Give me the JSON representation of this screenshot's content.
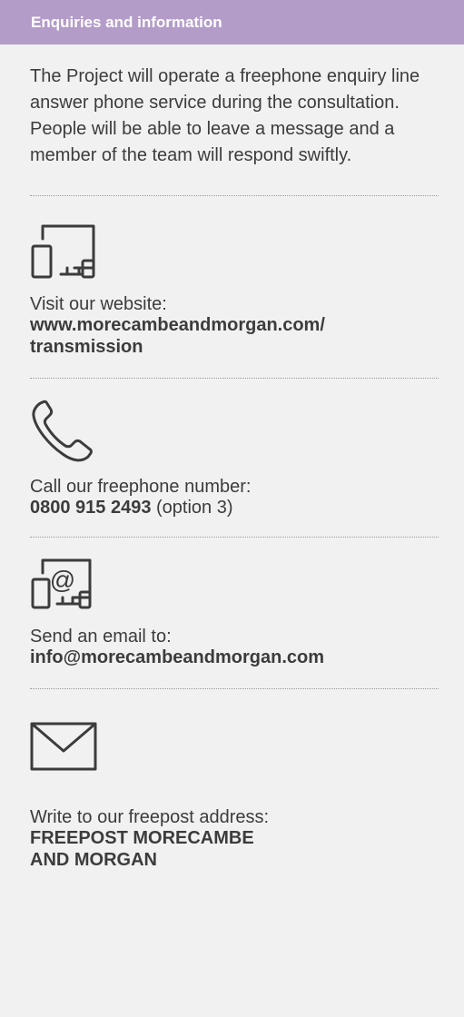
{
  "header": {
    "title": "Enquiries and information"
  },
  "intro": {
    "text": "The Project will operate a freephone enquiry line answer phone service during the consultation. People will be able to leave a message and a member of the team will respond swiftly."
  },
  "contacts": {
    "website": {
      "icon": "devices-icon",
      "label": "Visit our website:",
      "value_line1": "www.morecambeandmorgan.com/",
      "value_line2": "transmission"
    },
    "phone": {
      "icon": "phone-icon",
      "label": "Call our freephone number:",
      "value": "0800 915 2493",
      "suffix": " (option 3)"
    },
    "email": {
      "icon": "email-devices-icon",
      "label": "Send an email to:",
      "value": "info@morecambeandmorgan.com"
    },
    "post": {
      "icon": "envelope-icon",
      "label": "Write to our freepost address:",
      "value_line1": "FREEPOST MORECAMBE",
      "value_line2": "AND MORGAN"
    }
  },
  "colors": {
    "header_bg": "#b49cc9",
    "panel_bg": "#f1f1f2",
    "text": "#3c3c3c"
  }
}
